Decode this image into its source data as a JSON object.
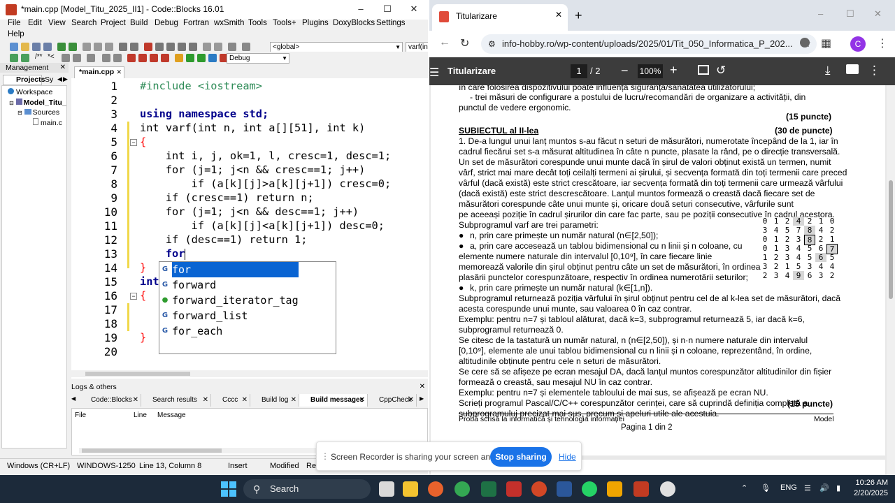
{
  "codeblocks": {
    "title": "*main.cpp [Model_Titu_2025_II1] - Code::Blocks 16.01",
    "menu": [
      "File",
      "Edit",
      "View",
      "Search",
      "Project",
      "Build",
      "Debug",
      "Fortran",
      "wxSmith",
      "Tools",
      "Tools+",
      "Plugins",
      "DoxyBlocks",
      "Settings",
      "Help"
    ],
    "scope_combo": "<global>",
    "symbol_combo": "varf(int n",
    "build_target": "Debug",
    "management": {
      "title": "Management",
      "tabs": [
        "Projects",
        "Sy"
      ],
      "tree": [
        {
          "label": "Workspace"
        },
        {
          "label": "Model_Titu_"
        },
        {
          "label": "Sources"
        },
        {
          "label": "main.c"
        }
      ]
    },
    "editor": {
      "tab": "*main.cpp",
      "line_numbers": [
        "1",
        "2",
        "3",
        "4",
        "5",
        "6",
        "7",
        "8",
        "9",
        "10",
        "11",
        "12",
        "13",
        "14",
        "15",
        "16",
        "17",
        "18",
        "19",
        "20"
      ],
      "lines": [
        "#include <iostream>",
        "",
        "using namespace std;",
        "int varf(int n, int a[][51], int k)",
        "{",
        "    int i, j, ok=1, l, cresc=1, desc=1;",
        "    for (j=1; j<n && cresc==1; j++)",
        "        if (a[k][j]>a[k][j+1]) cresc=0;",
        "    if (cresc==1) return n;",
        "    for (j=1; j<n && desc==1; j++)",
        "        if (a[k][j]<a[k][j+1]) desc=0;",
        "    if (desc==1) return 1;",
        "    for",
        "}",
        "int",
        "{",
        "",
        "",
        "}",
        ""
      ]
    },
    "autocomplete": [
      "for",
      "forward",
      "forward_iterator_tag",
      "forward_list",
      "for_each"
    ],
    "logs": {
      "title": "Logs & others",
      "tabs": [
        "Code::Blocks",
        "Search results",
        "Cccc",
        "Build log",
        "Build messages",
        "CppCheck"
      ],
      "active_tab": "Build messages",
      "columns": [
        "File",
        "Line",
        "Message"
      ]
    },
    "status": {
      "eol": "Windows (CR+LF)",
      "encoding": "WINDOWS-1250",
      "position": "Line 13, Column 8",
      "mode": "Insert",
      "modified": "Modified",
      "rw": "Re"
    }
  },
  "chrome": {
    "tab_title": "Titularizare",
    "url": "info-hobby.ro/wp-content/uploads/2025/01/Tit_050_Informatica_P_202...",
    "profile_initial": "C",
    "pdf": {
      "title": "Titularizare",
      "page_current": "1",
      "page_total": "/  2",
      "zoom": "100%",
      "lines": [
        "în care folosirea dispozitivului poate influența siguranța/sănătatea utilizatorului;",
        "- trei măsuri de configurare a postului de lucru/recomandări de organizare a activității, din",
        "punctul de vedere ergonomic.",
        "(15 puncte)",
        "SUBIECTUL al II-lea",
        "(30 de puncte)",
        "1. De-a lungul unui lanț muntos s-au făcut n seturi de măsurători, numerotate începând de la 1, iar în",
        "cadrul fiecărui set s-a măsurat altitudinea în câte n puncte, plasate la rând, pe o direcție transversală.",
        "Un set de măsurători corespunde unui munte dacă în șirul de valori obținut există un termen, numit",
        "vârf, strict mai mare decât toți ceilalți termeni ai șirului, și secvența formată din toți termenii care preced",
        "vârful (dacă există) este strict crescătoare, iar secvența formată din toți termenii care urmează vârfului",
        "(dacă există) este strict descrescătoare. Lanțul muntos formează o creastă dacă fiecare set de",
        "măsurători corespunde câte unui munte și, oricare două seturi consecutive, vârfurile sunt",
        "pe aceeași poziție în cadrul șirurilor din care fac parte, sau pe poziții consecutive în cadrul acestora.",
        "Subprogramul varf are trei parametri:",
        "n, prin care primește un număr natural (n∈[2,50]);",
        "a, prin care accesează un tablou bidimensional cu n linii și n coloane, cu",
        "elemente numere naturale din intervalul [0,10⁹], în care fiecare linie",
        "memorează valorile din șirul obținut pentru câte un set de măsurători, în ordinea",
        "plasării punctelor corespunzătoare, respectiv în ordinea numerotării seturilor;",
        "k, prin care primește un număr natural (k∈[1,n]).",
        "Subprogramul returnează poziția vârfului în șirul obținut pentru cel de al k-lea set de măsurători, dacă",
        "acesta corespunde unui munte, sau valoarea 0 în caz contrar.",
        "Exemplu: pentru n=7 și tabloul alăturat, dacă k=3, subprogramul returnează 5, iar dacă k=6,",
        "subprogramul returnează 0.",
        "Se citesc de la tastatură un număr natural, n (n∈[2,50]), și n·n numere naturale din intervalul",
        "[0,10⁹], elemente ale unui tablou bidimensional cu n linii și n coloane, reprezentând, în ordine,",
        "altitudinile obținute pentru cele n seturi de măsurători.",
        "Se cere să se afișeze pe ecran mesajul DA, dacă lanțul muntos corespunzător altitudinilor din fișier",
        "formează o creastă, sau mesajul NU în caz contrar.",
        "Exemplu: pentru n=7 și elementele tabloului de mai sus, se afișează pe ecran NU.",
        "Scrieți programul Pascal/C/C++ corespunzător cerinței, care să cuprindă definiția completă a",
        "subprogramului precizat mai sus, precum și apeluri utile ale acestuia.",
        "(15 puncte)",
        "Probă scrisă la informatică și tehnologia informației",
        "Model",
        "Pagina 1 din 2"
      ],
      "matrix": [
        [
          "0",
          "1",
          "2",
          "4",
          "2",
          "1",
          "0"
        ],
        [
          "3",
          "4",
          "5",
          "7",
          "8",
          "4",
          "2"
        ],
        [
          "0",
          "1",
          "2",
          "3",
          "8",
          "2",
          "1"
        ],
        [
          "0",
          "1",
          "3",
          "4",
          "5",
          "6",
          "7"
        ],
        [
          "1",
          "2",
          "3",
          "4",
          "5",
          "6",
          "5"
        ],
        [
          "3",
          "2",
          "1",
          "5",
          "3",
          "4",
          "4"
        ],
        [
          "2",
          "3",
          "4",
          "9",
          "6",
          "3",
          "2"
        ]
      ]
    }
  },
  "recorder": {
    "message": "Screen Recorder is sharing your screen and audio.",
    "stop": "Stop sharing",
    "hide": "Hide"
  },
  "taskbar": {
    "search": "Search",
    "lang": "ENG",
    "time": "10:26 AM",
    "date": "2/20/2025"
  },
  "colors": {
    "keyword": "#00008b",
    "preprocessor": "#2e8b57",
    "number": "#f07800",
    "operator": "#ff0000",
    "selection": "#0a64d2",
    "stop_button": "#1a73e8",
    "pdf_toolbar": "#3c3c3c",
    "taskbar": "#1c2a3a"
  }
}
